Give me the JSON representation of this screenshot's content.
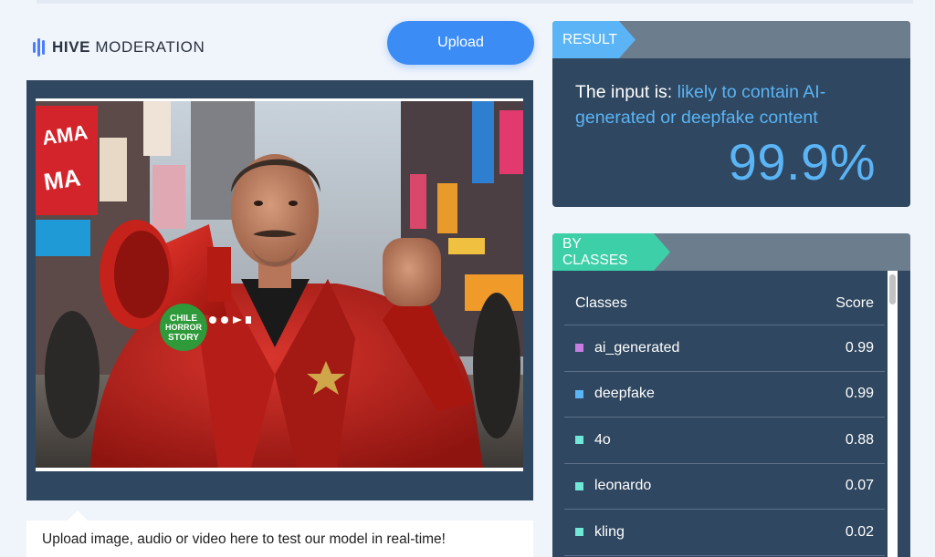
{
  "brand": {
    "name_bold": "HIVE",
    "name_rest": "MODERATION",
    "icon": "hive-logo-icon",
    "accent": "#4a7dff"
  },
  "upload": {
    "label": "Upload",
    "color": "#3c8cf5"
  },
  "caption": "Upload image, audio or video here to test our model in real-time!",
  "image": {
    "alt": "Man in red coat holding red megaphone in city street",
    "overlay_sticker": [
      "CHILE",
      "HORROR",
      "STORY"
    ]
  },
  "result": {
    "tag": "RESULT",
    "prefix": "The input is: ",
    "verdict": "likely to contain AI-generated or deepfake content",
    "score": "99.9%",
    "accent": "#5ab4f5"
  },
  "classes": {
    "tag": "BY CLASSES",
    "header": {
      "classes": "Classes",
      "score": "Score"
    },
    "rows": [
      {
        "name": "ai_generated",
        "score": "0.99",
        "color": "#c77de0"
      },
      {
        "name": "deepfake",
        "score": "0.99",
        "color": "#5ab4f5"
      },
      {
        "name": "4o",
        "score": "0.88",
        "color": "#6fe8d8"
      },
      {
        "name": "leonardo",
        "score": "0.07",
        "color": "#6fe8d8"
      },
      {
        "name": "kling",
        "score": "0.02",
        "color": "#6fe8d8"
      }
    ]
  }
}
